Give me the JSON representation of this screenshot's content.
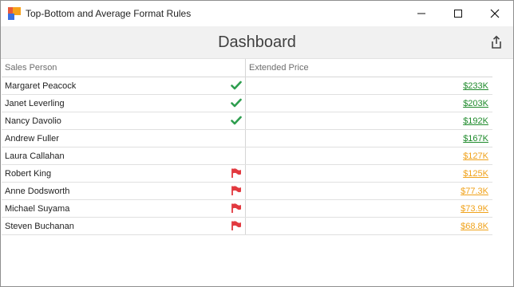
{
  "window": {
    "title": "Top-Bottom and Average Format Rules",
    "icon": "app-logo-icon",
    "controls": [
      "minimize-icon",
      "maximize-icon",
      "close-icon"
    ]
  },
  "dashboard": {
    "title": "Dashboard",
    "export_icon": "export-icon"
  },
  "grid": {
    "columns": [
      "Sales Person",
      "Extended Price"
    ],
    "rows": [
      {
        "name": "Margaret Peacock",
        "icon": "check",
        "price": "$233K",
        "price_color": "green"
      },
      {
        "name": "Janet Leverling",
        "icon": "check",
        "price": "$203K",
        "price_color": "green"
      },
      {
        "name": "Nancy Davolio",
        "icon": "check",
        "price": "$192K",
        "price_color": "green"
      },
      {
        "name": "Andrew Fuller",
        "icon": "",
        "price": "$167K",
        "price_color": "green"
      },
      {
        "name": "Laura Callahan",
        "icon": "",
        "price": "$127K",
        "price_color": "orange"
      },
      {
        "name": "Robert King",
        "icon": "flag",
        "price": "$125K",
        "price_color": "orange"
      },
      {
        "name": "Anne Dodsworth",
        "icon": "flag",
        "price": "$77.3K",
        "price_color": "orange"
      },
      {
        "name": "Michael Suyama",
        "icon": "flag",
        "price": "$73.9K",
        "price_color": "orange"
      },
      {
        "name": "Steven Buchanan",
        "icon": "flag",
        "price": "$68.8K",
        "price_color": "orange"
      }
    ]
  },
  "colors": {
    "green": "#1e8a2b",
    "orange": "#f0a21a",
    "check": "#2e9e4f",
    "flag": "#e2393f"
  }
}
